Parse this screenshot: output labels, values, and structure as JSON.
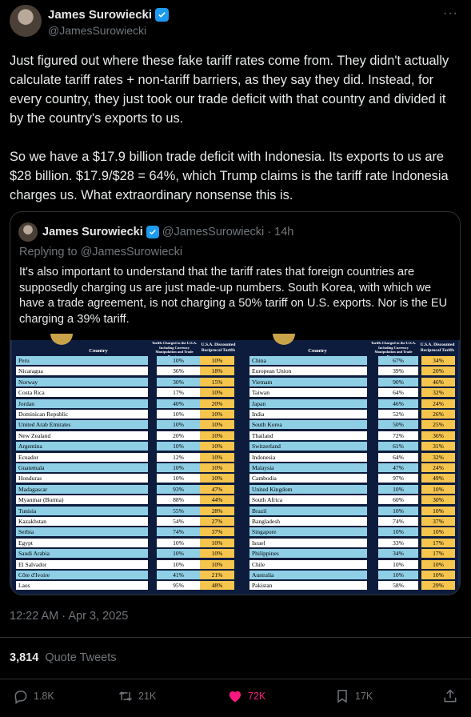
{
  "author": {
    "name": "James Surowiecki",
    "handle": "@JamesSurowiecki"
  },
  "more_icon": "more-horizontal-icon",
  "verified_icon": "verified-badge-icon",
  "tweet": {
    "paragraphs": [
      "Just figured out where these fake tariff rates come from. They didn't actually calculate tariff rates + non-tariff barriers, as they say they did. Instead, for every country, they just took our trade deficit with that country and divided it by the country's exports to us.",
      "So we have a $17.9 billion trade deficit with Indonesia. Its exports to us are $28 billion. $17.9/$28 = 64%, which Trump claims is the tariff rate Indonesia charges us. What extraordinary nonsense this is."
    ],
    "timestamp": "12:22 AM · Apr 3, 2025"
  },
  "quoted": {
    "name": "James Surowiecki",
    "handle": "@JamesSurowiecki",
    "separator": "·",
    "time": "14h",
    "replying_to": "Replying to @JamesSurowiecki",
    "text": "It's also important to understand that the tariff rates that foreign countries are supposedly charging us are just made-up numbers. South Korea, with which we have a trade agreement, is not charging a 50% tariff on U.S. exports. Nor is the EU charging a 39% tariff.",
    "table": {
      "header_country": "Country",
      "header_charged": "Tariffs Charged to the U.S.A. Including Currency Manipulation and Trade Barriers",
      "header_reciprocal": "U.S.A. Discounted Reciprocal Tariffs",
      "left_rows": [
        {
          "country": "Peru",
          "charged": "10%",
          "reciprocal": "10%"
        },
        {
          "country": "Nicaragua",
          "charged": "36%",
          "reciprocal": "18%"
        },
        {
          "country": "Norway",
          "charged": "30%",
          "reciprocal": "15%"
        },
        {
          "country": "Costa Rica",
          "charged": "17%",
          "reciprocal": "10%"
        },
        {
          "country": "Jordan",
          "charged": "40%",
          "reciprocal": "20%"
        },
        {
          "country": "Dominican Republic",
          "charged": "10%",
          "reciprocal": "10%"
        },
        {
          "country": "United Arab Emirates",
          "charged": "10%",
          "reciprocal": "10%"
        },
        {
          "country": "New Zealand",
          "charged": "20%",
          "reciprocal": "10%"
        },
        {
          "country": "Argentina",
          "charged": "10%",
          "reciprocal": "10%"
        },
        {
          "country": "Ecuador",
          "charged": "12%",
          "reciprocal": "10%"
        },
        {
          "country": "Guatemala",
          "charged": "10%",
          "reciprocal": "10%"
        },
        {
          "country": "Honduras",
          "charged": "10%",
          "reciprocal": "10%"
        },
        {
          "country": "Madagascar",
          "charged": "93%",
          "reciprocal": "47%"
        },
        {
          "country": "Myanmar (Burma)",
          "charged": "88%",
          "reciprocal": "44%"
        },
        {
          "country": "Tunisia",
          "charged": "55%",
          "reciprocal": "28%"
        },
        {
          "country": "Kazakhstan",
          "charged": "54%",
          "reciprocal": "27%"
        },
        {
          "country": "Serbia",
          "charged": "74%",
          "reciprocal": "37%"
        },
        {
          "country": "Egypt",
          "charged": "10%",
          "reciprocal": "10%"
        },
        {
          "country": "Saudi Arabia",
          "charged": "10%",
          "reciprocal": "10%"
        },
        {
          "country": "El Salvador",
          "charged": "10%",
          "reciprocal": "10%"
        },
        {
          "country": "Côte d'Ivoire",
          "charged": "41%",
          "reciprocal": "21%"
        },
        {
          "country": "Laos",
          "charged": "95%",
          "reciprocal": "48%"
        }
      ],
      "right_rows": [
        {
          "country": "China",
          "charged": "67%",
          "reciprocal": "34%"
        },
        {
          "country": "European Union",
          "charged": "39%",
          "reciprocal": "20%"
        },
        {
          "country": "Vietnam",
          "charged": "90%",
          "reciprocal": "46%"
        },
        {
          "country": "Taiwan",
          "charged": "64%",
          "reciprocal": "32%"
        },
        {
          "country": "Japan",
          "charged": "46%",
          "reciprocal": "24%"
        },
        {
          "country": "India",
          "charged": "52%",
          "reciprocal": "26%"
        },
        {
          "country": "South Korea",
          "charged": "50%",
          "reciprocal": "25%"
        },
        {
          "country": "Thailand",
          "charged": "72%",
          "reciprocal": "36%"
        },
        {
          "country": "Switzerland",
          "charged": "61%",
          "reciprocal": "31%"
        },
        {
          "country": "Indonesia",
          "charged": "64%",
          "reciprocal": "32%"
        },
        {
          "country": "Malaysia",
          "charged": "47%",
          "reciprocal": "24%"
        },
        {
          "country": "Cambodia",
          "charged": "97%",
          "reciprocal": "49%"
        },
        {
          "country": "United Kingdom",
          "charged": "10%",
          "reciprocal": "10%"
        },
        {
          "country": "South Africa",
          "charged": "60%",
          "reciprocal": "30%"
        },
        {
          "country": "Brazil",
          "charged": "10%",
          "reciprocal": "10%"
        },
        {
          "country": "Bangladesh",
          "charged": "74%",
          "reciprocal": "37%"
        },
        {
          "country": "Singapore",
          "charged": "10%",
          "reciprocal": "10%"
        },
        {
          "country": "Israel",
          "charged": "33%",
          "reciprocal": "17%"
        },
        {
          "country": "Philippines",
          "charged": "34%",
          "reciprocal": "17%"
        },
        {
          "country": "Chile",
          "charged": "10%",
          "reciprocal": "10%"
        },
        {
          "country": "Australia",
          "charged": "10%",
          "reciprocal": "10%"
        },
        {
          "country": "Pakistan",
          "charged": "58%",
          "reciprocal": "29%"
        }
      ],
      "colors": {
        "row_blue": "#8fcfe6",
        "row_white": "#ffffff",
        "reciprocal_yellow": "#f6c54e",
        "background": "#0d1c3d"
      }
    }
  },
  "stats": {
    "quote_count": "3,814",
    "quote_label": "Quote Tweets"
  },
  "actions": {
    "replies": "1.8K",
    "retweets": "21K",
    "likes": "72K",
    "bookmarks": "17K",
    "icons": [
      "reply-icon",
      "retweet-icon",
      "like-icon",
      "bookmark-icon",
      "share-icon"
    ]
  }
}
